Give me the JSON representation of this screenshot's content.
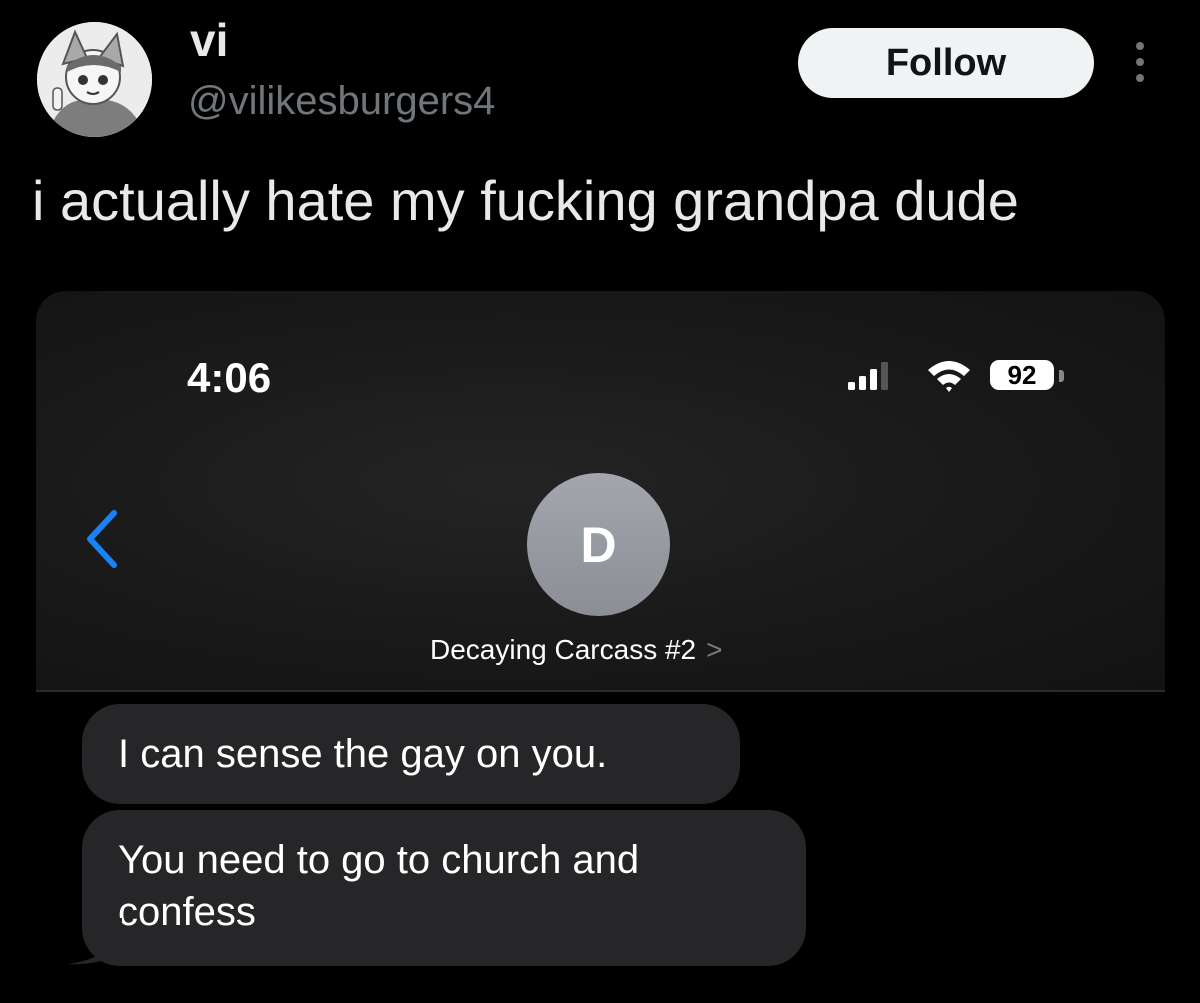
{
  "tweet": {
    "display_name": "vi",
    "handle": "@vilikesburgers4",
    "follow_label": "Follow",
    "text": "i actually hate my fucking grandpa dude"
  },
  "screenshot": {
    "status_bar": {
      "time": "4:06",
      "battery": "92"
    },
    "contact": {
      "initial": "D",
      "name": "Decaying Carcass #2",
      "chevron": ">"
    },
    "messages": [
      {
        "text": "I can sense the gay on you."
      },
      {
        "text": "You need to go to church and confess"
      }
    ]
  },
  "colors": {
    "background": "#000000",
    "follow_button_bg": "#eff3f4",
    "handle": "#71767b",
    "back_arrow": "#1a82f7",
    "bubble": "#262628",
    "contact_avatar": "#9a9ca4"
  },
  "icons": {
    "avatar": "anime-avatar",
    "more": "more-vertical-icon",
    "signal": "cellular-signal-icon",
    "wifi": "wifi-icon",
    "back": "chevron-left-icon"
  }
}
